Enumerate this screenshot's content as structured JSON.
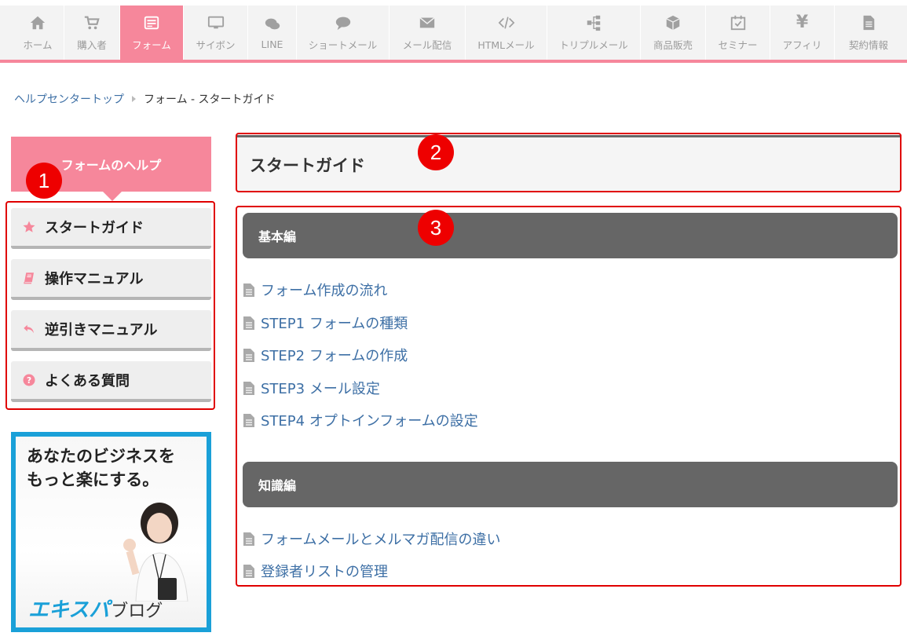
{
  "nav": {
    "items": [
      {
        "label": "ホーム",
        "icon": "home-icon"
      },
      {
        "label": "購入者",
        "icon": "cart-icon"
      },
      {
        "label": "フォーム",
        "icon": "form-icon"
      },
      {
        "label": "サイボン",
        "icon": "monitor-icon"
      },
      {
        "label": "LINE",
        "icon": "line-chat-icon"
      },
      {
        "label": "ショートメール",
        "icon": "speech-bubble-icon"
      },
      {
        "label": "メール配信",
        "icon": "envelope-icon"
      },
      {
        "label": "HTMLメール",
        "icon": "code-icon"
      },
      {
        "label": "トリプルメール",
        "icon": "hierarchy-icon"
      },
      {
        "label": "商品販売",
        "icon": "box-icon"
      },
      {
        "label": "セミナー",
        "icon": "calendar-check-icon"
      },
      {
        "label": "アフィリ",
        "icon": "yen-icon"
      },
      {
        "label": "契約情報",
        "icon": "document-icon"
      }
    ],
    "active_color": "#f6879b"
  },
  "breadcrumb": {
    "home": "ヘルプセンタートップ",
    "current": "フォーム - スタートガイド"
  },
  "sidebar": {
    "title": "フォームのヘルプ",
    "items": [
      {
        "label": "スタートガイド",
        "icon": "star-icon"
      },
      {
        "label": "操作マニュアル",
        "icon": "book-icon"
      },
      {
        "label": "逆引きマニュアル",
        "icon": "reply-arrow-icon"
      },
      {
        "label": "よくある質問",
        "icon": "question-circle-icon"
      }
    ]
  },
  "banner": {
    "line1": "あなたのビジネスを",
    "line2": "もっと楽にする。",
    "logo_main": "エキスパ",
    "logo_sub": "ブログ"
  },
  "main": {
    "title": "スタートガイド",
    "sections": [
      {
        "heading": "基本編",
        "links": [
          "フォーム作成の流れ",
          "STEP1 フォームの種類",
          "STEP2 フォームの作成",
          "STEP3 メール設定",
          "STEP4 オプトインフォームの設定"
        ]
      },
      {
        "heading": "知識編",
        "links": [
          "フォームメールとメルマガ配信の違い",
          "登録者リストの管理"
        ]
      }
    ]
  },
  "annotations": [
    "1",
    "2",
    "3"
  ]
}
